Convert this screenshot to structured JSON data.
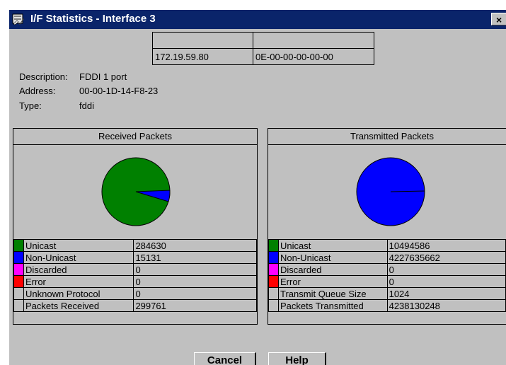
{
  "window": {
    "title": "I/F Statistics - Interface 3",
    "close_label": "×",
    "icon": "statistics-app-icon"
  },
  "address_table": {
    "rows": [
      [
        "",
        ""
      ],
      [
        "172.19.59.80",
        "0E-00-00-00-00-00"
      ]
    ]
  },
  "info": {
    "description_label": "Description:",
    "description_value": "FDDI 1 port",
    "address_label": "Address:",
    "address_value": "00-00-1D-14-F8-23",
    "type_label": "Type:",
    "type_value": "fddi"
  },
  "received": {
    "header": "Received Packets",
    "rows": [
      {
        "label": "Unicast",
        "value": "284630",
        "color": "#008000"
      },
      {
        "label": "Non-Unicast",
        "value": "15131",
        "color": "#0000ff"
      },
      {
        "label": "Discarded",
        "value": "0",
        "color": "#ff00ff"
      },
      {
        "label": "Error",
        "value": "0",
        "color": "#ff0000"
      },
      {
        "label": "Unknown Protocol",
        "value": "0",
        "color": ""
      },
      {
        "label": "Packets Received",
        "value": "299761",
        "color": ""
      }
    ]
  },
  "transmitted": {
    "header": "Transmitted Packets",
    "rows": [
      {
        "label": "Unicast",
        "value": "10494586",
        "color": "#008000"
      },
      {
        "label": "Non-Unicast",
        "value": "4227635662",
        "color": "#0000ff"
      },
      {
        "label": "Discarded",
        "value": "0",
        "color": "#ff00ff"
      },
      {
        "label": "Error",
        "value": "0",
        "color": "#ff0000"
      },
      {
        "label": "Transmit Queue Size",
        "value": "1024",
        "color": ""
      },
      {
        "label": "Packets Transmitted",
        "value": "4238130248",
        "color": ""
      }
    ]
  },
  "buttons": {
    "cancel": "Cancel",
    "help": "Help"
  }
}
